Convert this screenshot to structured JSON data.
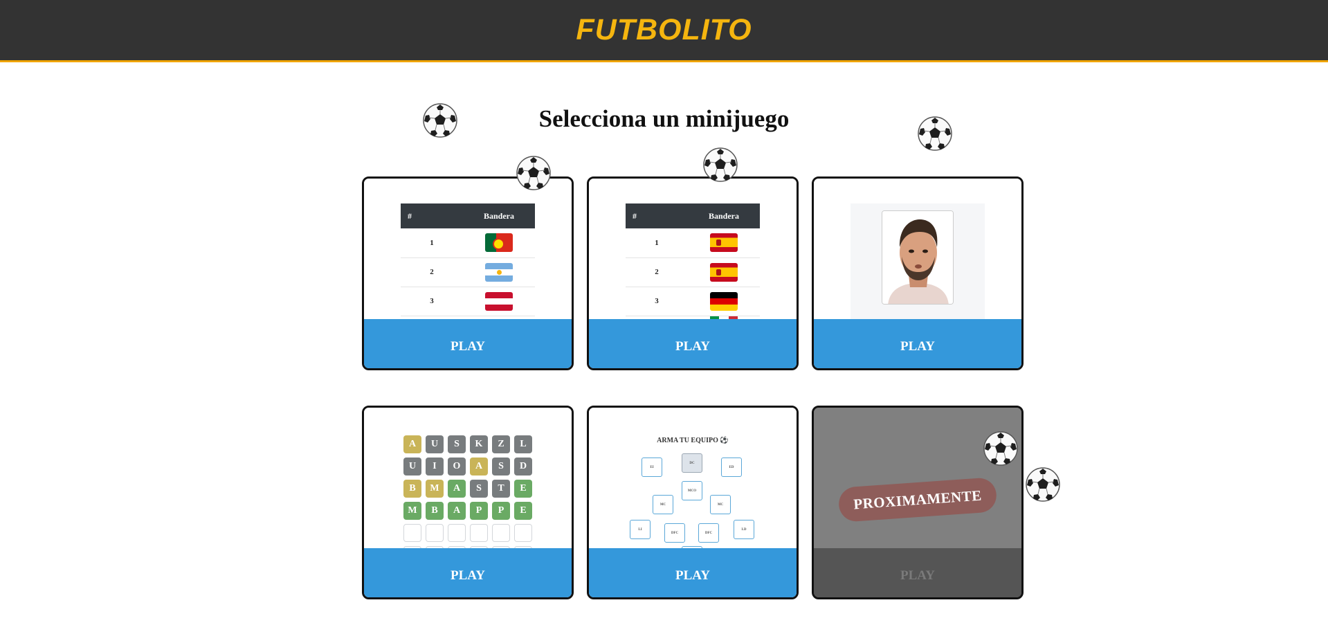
{
  "app": {
    "title": "FUTBOLITO"
  },
  "page": {
    "heading": "Selecciona un minijuego"
  },
  "cards": [
    {
      "play_label": "PLAY",
      "table": {
        "headers": [
          "#",
          "Bandera"
        ],
        "rows": [
          {
            "rank": "1",
            "flag": "flag-portugal"
          },
          {
            "rank": "2",
            "flag": "flag-argentina"
          },
          {
            "rank": "3",
            "flag": "flag-austria"
          }
        ]
      }
    },
    {
      "play_label": "PLAY",
      "table": {
        "headers": [
          "#",
          "Bandera"
        ],
        "rows": [
          {
            "rank": "1",
            "flag": "flag-spain"
          },
          {
            "rank": "2",
            "flag": "flag-spain"
          },
          {
            "rank": "3",
            "flag": "flag-germany"
          }
        ]
      }
    },
    {
      "play_label": "PLAY",
      "image": "player-portrait"
    },
    {
      "play_label": "PLAY",
      "wordle_rows": [
        [
          [
            "A",
            "y"
          ],
          [
            "U",
            "g"
          ],
          [
            "S",
            "g"
          ],
          [
            "K",
            "g"
          ],
          [
            "Z",
            "g"
          ],
          [
            "L",
            "g"
          ]
        ],
        [
          [
            "U",
            "g"
          ],
          [
            "I",
            "g"
          ],
          [
            "O",
            "g"
          ],
          [
            "A",
            "y"
          ],
          [
            "S",
            "g"
          ],
          [
            "D",
            "g"
          ]
        ],
        [
          [
            "B",
            "y"
          ],
          [
            "M",
            "y"
          ],
          [
            "A",
            "gr"
          ],
          [
            "S",
            "g"
          ],
          [
            "T",
            "g"
          ],
          [
            "E",
            "gr"
          ]
        ],
        [
          [
            "M",
            "gr"
          ],
          [
            "B",
            "gr"
          ],
          [
            "A",
            "gr"
          ],
          [
            "P",
            "gr"
          ],
          [
            "P",
            "gr"
          ],
          [
            "E",
            "gr"
          ]
        ]
      ]
    },
    {
      "play_label": "PLAY",
      "team_title": "ARMA TU EQUIPO ⚽",
      "positions": [
        "EI",
        "DC",
        "ED",
        "MCO",
        "MC",
        "MC",
        "LI",
        "DFC",
        "DFC",
        "LD"
      ]
    },
    {
      "play_label": "PLAY",
      "badge": "PROXIMAMENTE",
      "disabled": true
    }
  ],
  "colors": {
    "accent": "#f5b50f",
    "play": "#3498db",
    "topbar": "#333333"
  },
  "decor": {
    "ball_icon": "soccer-ball-icon"
  }
}
